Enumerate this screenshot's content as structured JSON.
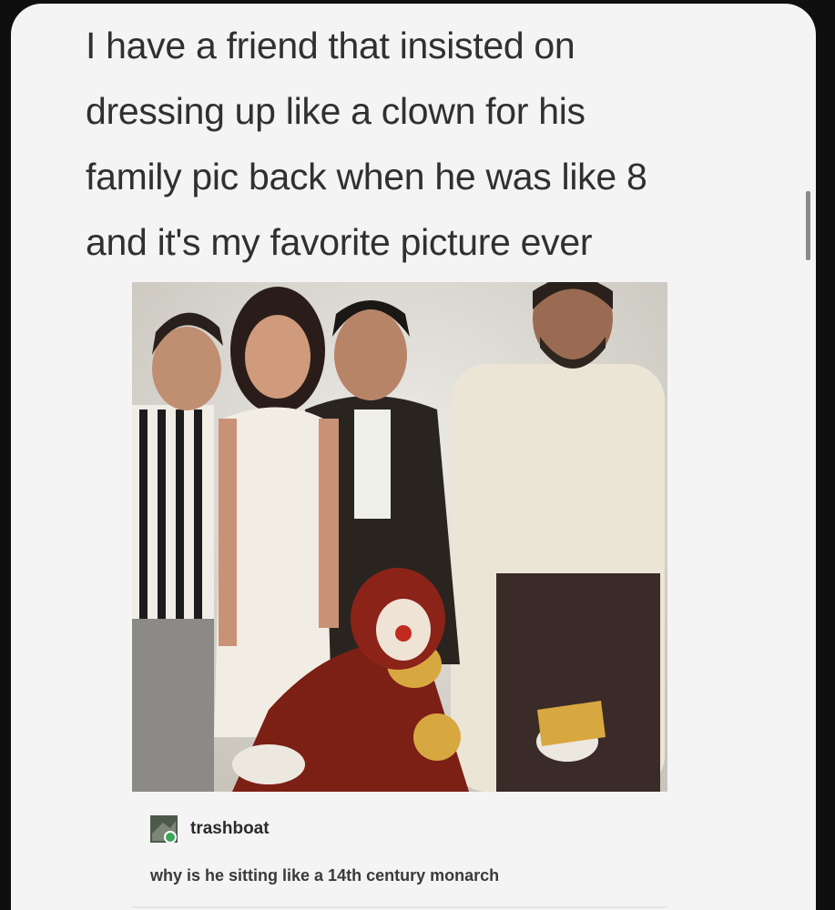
{
  "post": {
    "text": "I have a friend that insisted on\ndressing up like a clown for his\nfamily pic back when he was like 8\nand it's my favorite picture ever"
  },
  "photo": {
    "subject": "family portrait with a child dressed as a clown"
  },
  "reply": {
    "username": "trashboat",
    "text": "why is he sitting like a 14th century monarch",
    "avatar_icon": "trashboat-avatar-icon"
  },
  "colors": {
    "background": "#0f0f0f",
    "card": "#f4f4f4",
    "text": "#303030"
  }
}
